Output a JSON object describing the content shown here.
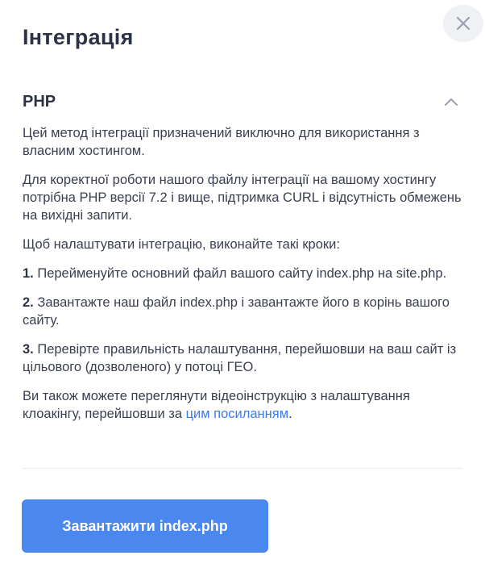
{
  "modal": {
    "title": "Інтеграція",
    "close_icon": "close-icon"
  },
  "section": {
    "title": "PHP",
    "toggle_icon": "chevron-up-icon",
    "paragraphs": {
      "p1": "Цей метод інтеграції призначений виключно для використання з власним хостингом.",
      "p2": "Для коректної роботи нашого файлу інтеграції на вашому хостингу потрібна PHP версії 7.2 і вище, підтримка CURL і відсутність обмежень на вихідні запити.",
      "p3": "Щоб налаштувати інтеграцію, виконайте такі кроки:",
      "step1_num": "1.",
      "step1_text": " Перейменуйте основний файл вашого сайту index.php на site.php.",
      "step2_num": "2.",
      "step2_text": " Завантажте наш файл index.php і завантажте його в корінь вашого сайту.",
      "step3_num": "3.",
      "step3_text": " Перевірте правильність налаштування, перейшовши на ваш сайт із цільового (дозволеного) у потоці ГЕО.",
      "p4_before": "Ви також можете переглянути відеоінструкцію з налаштування клоакінгу, перейшовши за ",
      "p4_link": "цим посиланням",
      "p4_after": "."
    }
  },
  "actions": {
    "download_label": "Завантажити index.php"
  },
  "colors": {
    "accent": "#4a88f0",
    "link": "#3b7cf0",
    "text": "#2d3346"
  }
}
